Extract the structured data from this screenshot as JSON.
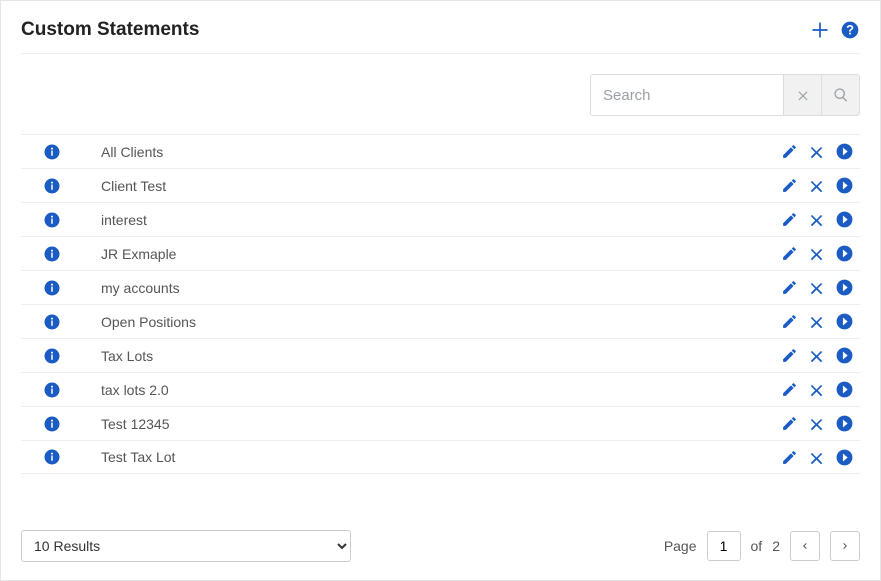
{
  "header": {
    "title": "Custom Statements"
  },
  "search": {
    "placeholder": "Search",
    "value": ""
  },
  "rows": [
    {
      "label": "All Clients"
    },
    {
      "label": "Client Test"
    },
    {
      "label": "interest"
    },
    {
      "label": "JR Exmaple"
    },
    {
      "label": "my accounts"
    },
    {
      "label": "Open Positions"
    },
    {
      "label": "Tax Lots"
    },
    {
      "label": "tax lots 2.0"
    },
    {
      "label": "Test 12345"
    },
    {
      "label": "Test Tax Lot"
    }
  ],
  "footer": {
    "page_size_label": "10 Results",
    "page_label": "Page",
    "page_current": "1",
    "page_of": "of",
    "page_total": "2"
  }
}
